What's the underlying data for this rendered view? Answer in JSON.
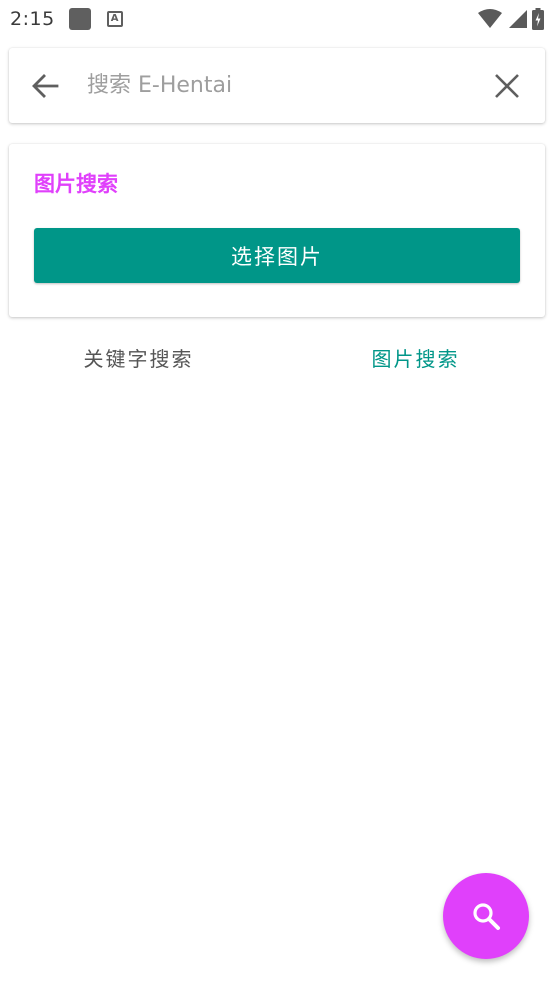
{
  "status_bar": {
    "time": "2:15",
    "notification_icons": [
      "square-notification-icon",
      "a-notification-icon"
    ],
    "right_icons": [
      "wifi-icon",
      "signal-icon",
      "battery-icon"
    ]
  },
  "search_bar": {
    "placeholder": "搜索 E-Hentai",
    "value": ""
  },
  "image_search_card": {
    "title": "图片搜索",
    "select_button_label": "选择图片"
  },
  "tabs": [
    {
      "label": "关键字搜索",
      "selected": false
    },
    {
      "label": "图片搜索",
      "selected": true
    }
  ],
  "colors": {
    "accent": "#e040fb",
    "primary": "#009688",
    "tab_inactive": "#555555"
  },
  "fab": {
    "icon": "search-icon"
  }
}
